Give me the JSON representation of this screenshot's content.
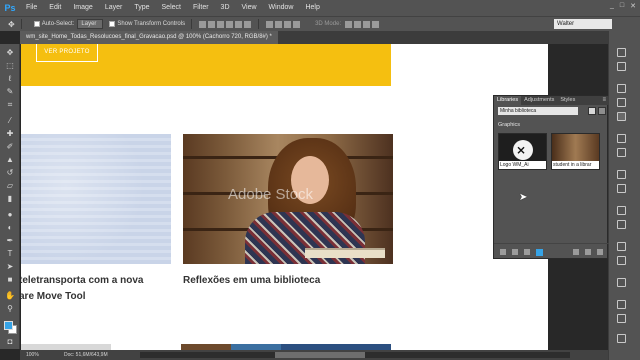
{
  "app": {
    "logo": "Ps"
  },
  "menu": [
    "File",
    "Edit",
    "Image",
    "Layer",
    "Type",
    "Select",
    "Filter",
    "3D",
    "View",
    "Window",
    "Help"
  ],
  "window_controls": [
    "_",
    "□",
    "✕"
  ],
  "options": {
    "auto_select_label": "Auto-Select:",
    "auto_select_value": "Layer",
    "transform_label": "Show Transform Controls",
    "mode_3d_label": "3D Mode:",
    "workspace": "Walter"
  },
  "document": {
    "tab": "wm_site_Home_Todas_Resolucoes_final_Gravacao.psd @ 100% (Cachorro 720, RGB/8#) *"
  },
  "canvas": {
    "button_label": "VER PROJETO",
    "caption_left_line1": "teletransporta com a nova",
    "caption_left_line2": "are Move Tool",
    "caption_right": "Reflexões em uma biblioteca",
    "watermark": "Adobe Stock"
  },
  "status": {
    "zoom": "100%",
    "doc": "Doc: 51,6M/643,9M"
  },
  "libraries": {
    "tabs": [
      "Libraries",
      "Adjustments",
      "Styles"
    ],
    "menu_icon": "≡",
    "library_select": "Minha biblioteca",
    "section": "Graphics",
    "items": [
      {
        "label": "Logo WM_Ai"
      },
      {
        "label": "student in a librar"
      }
    ]
  },
  "tools": [
    "move-icon",
    "marquee-icon",
    "lasso-icon",
    "quick-select-icon",
    "crop-icon",
    "eyedropper-icon",
    "healing-icon",
    "brush-icon",
    "clone-stamp-icon",
    "history-brush-icon",
    "eraser-icon",
    "gradient-icon",
    "blur-icon",
    "dodge-icon",
    "pen-icon",
    "type-icon",
    "path-select-icon",
    "shape-icon",
    "hand-icon",
    "zoom-icon"
  ],
  "colors": {
    "foreground": "#36a3e6",
    "background": "#ffffff",
    "accent_yellow": "#f5bf10"
  }
}
